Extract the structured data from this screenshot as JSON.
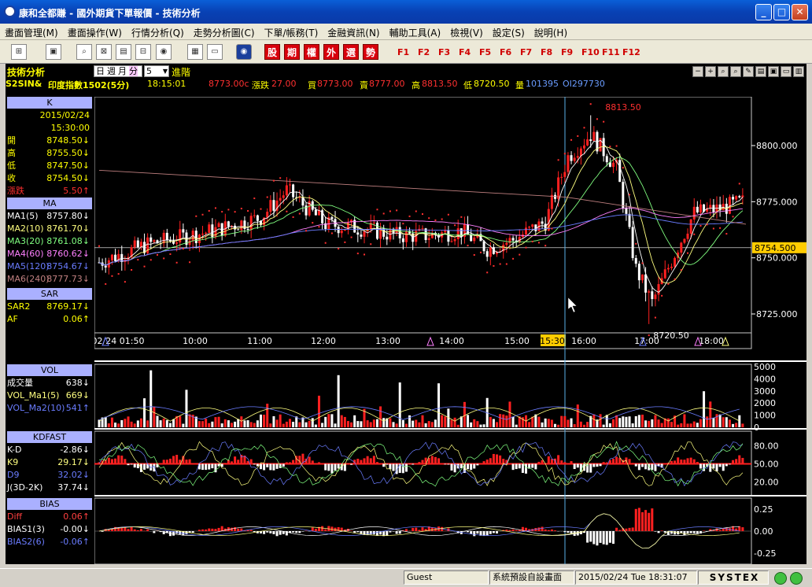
{
  "window": {
    "title": "康和全都賺 - 國外期貨下單報價 - 技術分析"
  },
  "menu": [
    "畫面管理(M)",
    "畫面操作(W)",
    "行情分析(Q)",
    "走勢分析圖(C)",
    "下單/帳務(T)",
    "金融資訊(N)",
    "輔助工具(A)",
    "檢視(V)",
    "設定(S)",
    "說明(H)"
  ],
  "toolbar": {
    "red_buttons": [
      "股",
      "期",
      "權",
      "外",
      "選",
      "勢"
    ],
    "fkeys": [
      "F1",
      "F2",
      "F3",
      "F4",
      "F5",
      "F6",
      "F7",
      "F8",
      "F9",
      "F10",
      "F11",
      "F12"
    ]
  },
  "panel": {
    "title": "技術分析",
    "periods": [
      "日",
      "週",
      "月",
      "分"
    ],
    "interval": "5",
    "advanced": "進階"
  },
  "quote": {
    "symbol": "S2SIN&",
    "name": "印度指數1502(5分)",
    "time": "18:15:01",
    "last": "8773.00c",
    "chg_label": "漲跌",
    "chg": "27.00",
    "bid_label": "買",
    "bid": "8773.00",
    "ask_label": "賣",
    "ask": "8777.00",
    "high_label": "高",
    "high": "8813.50",
    "low_label": "低",
    "low": "8720.50",
    "vol_label": "量",
    "vol": "101395",
    "oi": "OI297730"
  },
  "k_panel": {
    "header": "K",
    "date": "2015/02/24",
    "time": "15:30:00",
    "rows": [
      {
        "k": "開",
        "v": "8748.50↓"
      },
      {
        "k": "高",
        "v": "8755.50↓"
      },
      {
        "k": "低",
        "v": "8747.50↓"
      },
      {
        "k": "收",
        "v": "8754.50↓"
      },
      {
        "k": "漲跌",
        "v": "5.50↑"
      }
    ]
  },
  "ma_panel": {
    "header": "MA",
    "rows": [
      {
        "k": "MA1(5)",
        "v": "8757.80↓",
        "c": "#ffffff"
      },
      {
        "k": "MA2(10)",
        "v": "8761.70↓",
        "c": "#ffff80"
      },
      {
        "k": "MA3(20)",
        "v": "8761.08↓",
        "c": "#80ff80"
      },
      {
        "k": "MA4(60)",
        "v": "8760.62↓",
        "c": "#ff80ff"
      },
      {
        "k": "MA5(120)",
        "v": "8754.67↓",
        "c": "#6a7cff"
      },
      {
        "k": "MA6(240)",
        "v": "8777.73↓",
        "c": "#c08080"
      }
    ]
  },
  "sar_panel": {
    "header": "SAR",
    "rows": [
      {
        "k": "SAR2",
        "v": "8769.17↓"
      },
      {
        "k": "AF",
        "v": "0.06↑"
      }
    ]
  },
  "vol_panel": {
    "header": "VOL",
    "rows": [
      {
        "k": "成交量",
        "v": "638↓",
        "c": "#ffffff"
      },
      {
        "k": "VOL_Ma1(5)",
        "v": "669↓",
        "c": "#ffff80"
      },
      {
        "k": "VOL_Ma2(10)",
        "v": "541↑",
        "c": "#6a7cff"
      }
    ]
  },
  "kd_panel": {
    "header": "KDFAST",
    "rows": [
      {
        "k": "K-D",
        "v": "-2.86↓",
        "c": "#ffffff"
      },
      {
        "k": "K9",
        "v": "29.17↓",
        "c": "#ffff80"
      },
      {
        "k": "D9",
        "v": "32.02↓",
        "c": "#6a7cff"
      },
      {
        "k": "J(3D-2K)",
        "v": "37.74↓",
        "c": "#ffffff"
      }
    ]
  },
  "bias_panel": {
    "header": "BIAS",
    "rows": [
      {
        "k": "Diff",
        "v": "0.06↑",
        "c": "#ff4040"
      },
      {
        "k": "BIAS1(3)",
        "v": "-0.00↓",
        "c": "#ffffff"
      },
      {
        "k": "BIAS2(6)",
        "v": "-0.06↑",
        "c": "#6a7cff"
      }
    ]
  },
  "price_axis": {
    "ticks": [
      "8800.000",
      "8775.000",
      "8750.000",
      "8725.000"
    ],
    "current": "8754.500",
    "tick_values": [
      8800,
      8775,
      8750,
      8725
    ],
    "current_value": 8754.5
  },
  "time_axis": {
    "labels": [
      "02/24 01:50",
      "10:00",
      "11:00",
      "12:00",
      "13:00",
      "14:00",
      "15:00",
      "15:30",
      "16:00",
      "17:00",
      "18:00"
    ]
  },
  "annotations": {
    "high": "8813.50",
    "low": "8720.50"
  },
  "vol_axis": [
    "5000",
    "4000",
    "3000",
    "2000",
    "1000",
    "0"
  ],
  "kd_axis": [
    "80.00",
    "50.00",
    "20.00"
  ],
  "bias_axis": [
    "0.25",
    "0.00",
    "-0.25"
  ],
  "status": {
    "user": "Guest",
    "layout": "系統預設自設畫面",
    "datetime": "2015/02/24 Tue 18:31:07",
    "brand": "SYSTEX"
  },
  "colors": {
    "up": "#ff2020",
    "down": "#ffffff",
    "sar": "#ff3030",
    "cursor": "#5ab0e8",
    "current_price": "#ffcc00"
  }
}
